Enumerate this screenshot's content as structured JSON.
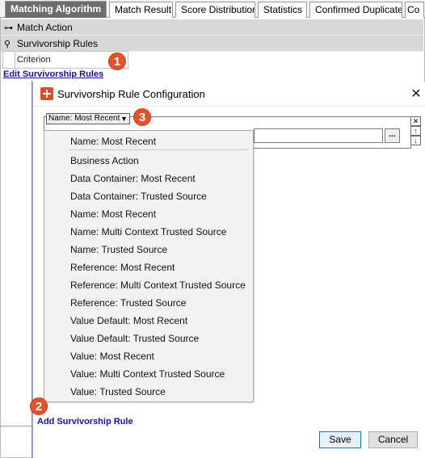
{
  "tabs": [
    {
      "label": "Matching Algorithm",
      "active": true
    },
    {
      "label": "Match Result",
      "active": false
    },
    {
      "label": "Score Distribution",
      "active": false
    },
    {
      "label": "Statistics",
      "active": false
    },
    {
      "label": "Confirmed Duplicates",
      "active": false
    },
    {
      "label": "Co",
      "active": false
    }
  ],
  "tree": {
    "match_action": "Match Action",
    "survivorship_rules": "Survivorship Rules",
    "criterion": "Criterion",
    "edit_link": "Edit Survivorship Rules"
  },
  "callouts": {
    "one": "1",
    "two": "2",
    "three": "3"
  },
  "dialog": {
    "title": "Survivorship Rule Configuration",
    "close": "✕",
    "selected_rule": "Name: Most Recent",
    "select_arrow": "▼",
    "browse_label": "...",
    "side_ctrls": [
      "✕",
      "↑",
      "↓"
    ],
    "add_link": "Add Survivorship Rule",
    "save_label": "Save",
    "cancel_label": "Cancel"
  },
  "dropdown": {
    "header": "Name: Most Recent",
    "options": [
      "Business Action",
      "Data Container: Most Recent",
      "Data Container: Trusted Source",
      "Name: Most Recent",
      "Name: Multi Context Trusted Source",
      "Name: Trusted Source",
      "Reference: Most Recent",
      "Reference: Multi Context Trusted Source",
      "Reference: Trusted Source",
      "Value Default: Most Recent",
      "Value Default: Trusted Source",
      "Value: Most Recent",
      "Value: Multi Context Trusted Source",
      "Value: Trusted Source"
    ]
  },
  "colors": {
    "active_tab": "#6d6d6d",
    "callout": "#e5522a",
    "link": "#1a0dab",
    "title_icon": "#e04a2a"
  },
  "icons": {
    "match_action": "key-icon",
    "survivorship_rules": "pin-icon",
    "title": "app-icon"
  }
}
